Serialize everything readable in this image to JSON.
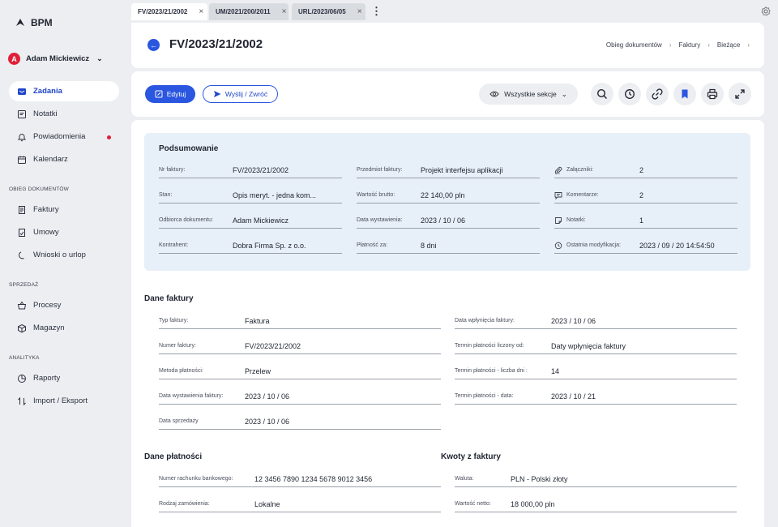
{
  "app": {
    "name": "BPM"
  },
  "user": {
    "initial": "A",
    "name": "Adam Mickiewicz"
  },
  "sidebar": {
    "main": [
      {
        "label": "Zadania"
      },
      {
        "label": "Notatki"
      },
      {
        "label": "Powiadomienia"
      },
      {
        "label": "Kalendarz"
      }
    ],
    "sections": [
      {
        "title": "OBIEG DOKUMENTÓW",
        "items": [
          {
            "label": "Faktury"
          },
          {
            "label": "Umowy"
          },
          {
            "label": "Wnioski o urlop"
          }
        ]
      },
      {
        "title": "SPRZEDAŻ",
        "items": [
          {
            "label": "Procesy"
          },
          {
            "label": "Magazyn"
          }
        ]
      },
      {
        "title": "ANALITYKA",
        "items": [
          {
            "label": "Raporty"
          },
          {
            "label": "Import / Eksport"
          }
        ]
      }
    ]
  },
  "tabs": [
    {
      "label": "FV/2023/21/2002"
    },
    {
      "label": "UM/2021/200/2011"
    },
    {
      "label": "URL/2023/06/05"
    }
  ],
  "header": {
    "title": "FV/2023/21/2002",
    "breadcrumb": [
      "Obieg dokumentów",
      "Faktury",
      "Bieżące"
    ]
  },
  "toolbar": {
    "edit_label": "Edytuj",
    "send_label": "Wyślij / Zwróć",
    "sections_label": "Wszystkie sekcje"
  },
  "summary": {
    "title": "Podsumowanie",
    "col1": [
      {
        "label": "Nr faktury:",
        "value": "FV/2023/21/2002"
      },
      {
        "label": "Stan:",
        "value": "Opis meryt. - jedna kom..."
      },
      {
        "label": "Odbiorca dokumentu:",
        "value": "Adam Mickiewicz"
      },
      {
        "label": "Kontrahent:",
        "value": "Dobra Firma Sp. z o.o."
      }
    ],
    "col2": [
      {
        "label": "Przedmiot faktury:",
        "value": "Projekt interfejsu aplikacji"
      },
      {
        "label": "Wartość brutto:",
        "value": "22 140,00 pln"
      },
      {
        "label": "Data wystawienia:",
        "value": "2023 / 10 / 06"
      },
      {
        "label": "Płatność za:",
        "value": "8 dni"
      }
    ],
    "col3": [
      {
        "label": "Załączniki:",
        "value": "2",
        "icon": "paperclip-icon"
      },
      {
        "label": "Komentarze:",
        "value": "2",
        "icon": "comment-icon"
      },
      {
        "label": "Notatki:",
        "value": "1",
        "icon": "note-icon"
      },
      {
        "label": "Ostatnia modyfikacja:",
        "value": "2023 / 09 / 20  14:54:50",
        "icon": "history-icon"
      }
    ]
  },
  "invoice": {
    "title": "Dane faktury",
    "left": [
      {
        "label": "Typ faktury:",
        "value": "Faktura"
      },
      {
        "label": "Numer faktury:",
        "value": "FV/2023/21/2002"
      },
      {
        "label": "Metoda płatności:",
        "value": "Przelew"
      },
      {
        "label": "Data wystawienia faktury:",
        "value": "2023 / 10 / 06"
      },
      {
        "label": "Data sprzedaży",
        "value": "2023 / 10 / 06"
      }
    ],
    "right": [
      {
        "label": "Data wpłynięcia faktury:",
        "value": "2023 / 10 / 06"
      },
      {
        "label": "Termin płatności liczony od:",
        "value": "Daty wpłynięcia faktury"
      },
      {
        "label": "Termin płatności - liczba dni :",
        "value": "14"
      },
      {
        "label": "Termin płatności - data:",
        "value": "2023 / 10 / 21"
      }
    ]
  },
  "payment": {
    "title": "Dane płatności",
    "rows": [
      {
        "label": "Numer rachunku bankowego:",
        "value": "12 3456 7890 1234 5678 9012 3456"
      },
      {
        "label": "Rodzaj zamówienia:",
        "value": "Lokalne"
      }
    ]
  },
  "amounts": {
    "title": "Kwoty z faktury",
    "rows": [
      {
        "label": "Waluta:",
        "value": "PLN - Polski złoty"
      },
      {
        "label": "Wartość netto:",
        "value": "18 000,00 pln"
      }
    ]
  },
  "colors": {
    "accent": "#2a56e0",
    "danger": "#e0203a",
    "summary_bg": "#e7eff8"
  }
}
